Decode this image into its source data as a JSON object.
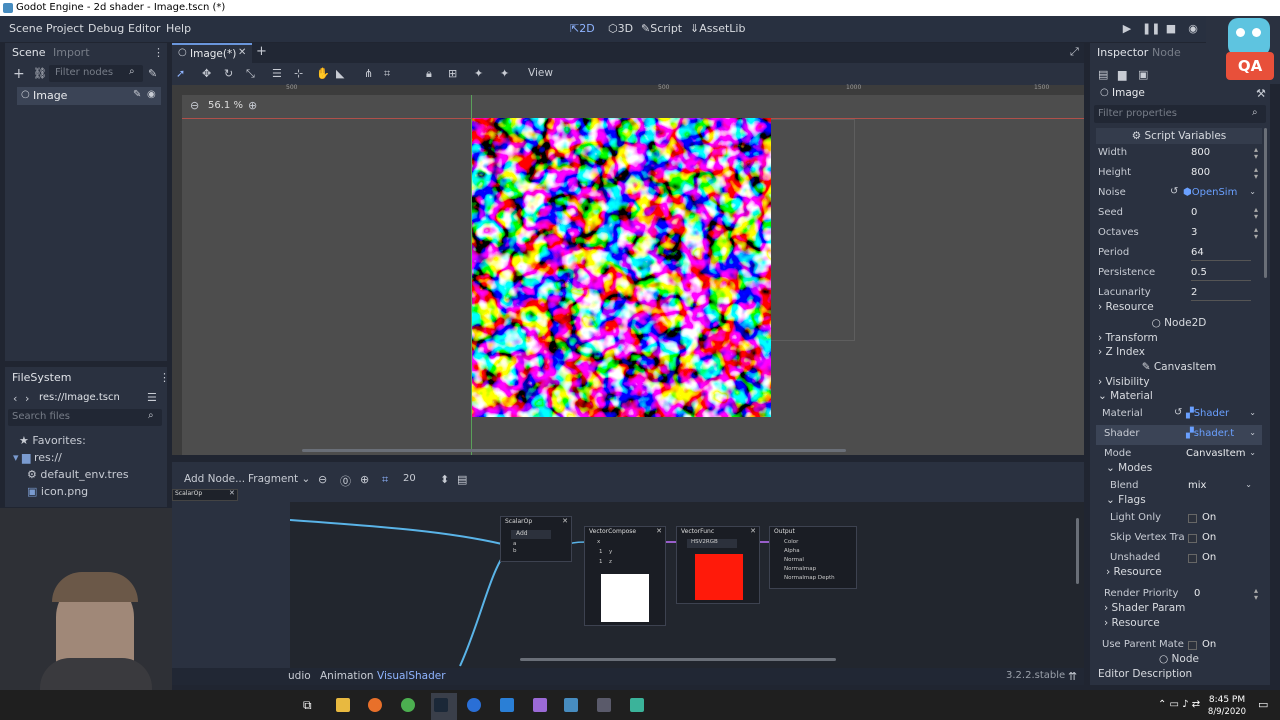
{
  "window": {
    "title": "Godot Engine - 2d shader - Image.tscn (*)"
  },
  "menu": [
    "Scene",
    "Project",
    "Debug",
    "Editor",
    "Help"
  ],
  "workspaces": [
    {
      "label": "2D",
      "icon": "2d-icon",
      "active": true
    },
    {
      "label": "3D",
      "icon": "3d-icon",
      "active": false
    },
    {
      "label": "Script",
      "icon": "script-icon",
      "active": false
    },
    {
      "label": "AssetLib",
      "icon": "assetlib-icon",
      "active": false
    }
  ],
  "scene_dock": {
    "tabs": [
      "Scene",
      "Import"
    ],
    "filter_placeholder": "Filter nodes",
    "tree": [
      {
        "label": "Image",
        "selected": true
      }
    ]
  },
  "filesystem_dock": {
    "title": "FileSystem",
    "path": "res://Image.tscn",
    "search_placeholder": "Search files",
    "items": [
      {
        "label": "Favorites:",
        "icon": "star-icon"
      },
      {
        "label": "res://",
        "icon": "folder-icon"
      },
      {
        "label": "default_env.tres",
        "icon": "resource-icon"
      },
      {
        "label": "icon.png",
        "icon": "image-icon"
      }
    ]
  },
  "editor_tabs": [
    {
      "label": "Image(*)",
      "closable": true
    }
  ],
  "viewport": {
    "zoom": "56.1 %",
    "view_menu": "View",
    "ruler_marks": [
      "500",
      "500",
      "1000",
      "1500"
    ],
    "colors": {
      "background": "#4d4d4d",
      "canvas": "#505050"
    }
  },
  "shader_editor": {
    "add_node": "Add Node...",
    "mode": "Fragment",
    "snap_value": "20",
    "mini_tab": "ScalarOp",
    "nodes": {
      "scalar_op": {
        "title": "ScalarOp",
        "op": "Add",
        "ports": [
          "a",
          "b"
        ]
      },
      "vector_compose": {
        "title": "VectorCompose",
        "ports": [
          "x",
          "y",
          "z"
        ],
        "values": [
          "1",
          "1"
        ]
      },
      "vector_func": {
        "title": "VectorFunc",
        "func": "HSV2RGB",
        "preview_color": "#ff1a0a"
      },
      "output": {
        "title": "Output",
        "ports": [
          "Color",
          "Alpha",
          "Normal",
          "Normalmap",
          "Normalmap Depth"
        ]
      }
    },
    "bottom_tabs": [
      "udio",
      "Animation",
      "VisualShader"
    ],
    "version": "3.2.2.stable"
  },
  "inspector": {
    "tabs": [
      "Inspector",
      "Node"
    ],
    "node_name": "Image",
    "filter_placeholder": "Filter properties",
    "script_variables": "Script Variables",
    "props": [
      {
        "label": "Width",
        "value": "800"
      },
      {
        "label": "Height",
        "value": "800"
      },
      {
        "label": "Noise",
        "value": "OpenSim"
      },
      {
        "label": "Seed",
        "value": "0"
      },
      {
        "label": "Octaves",
        "value": "3"
      },
      {
        "label": "Period",
        "value": "64"
      },
      {
        "label": "Persistence",
        "value": "0.5"
      },
      {
        "label": "Lacunarity",
        "value": "2"
      }
    ],
    "resource": "Resource",
    "node2d": "Node2D",
    "transform": "Transform",
    "zindex": "Z Index",
    "canvasitem": "CanvasItem",
    "visibility": "Visibility",
    "material_section": "Material",
    "material": {
      "label": "Material",
      "value": "Shader"
    },
    "shader": {
      "label": "Shader",
      "value": "shader.t"
    },
    "mode": {
      "label": "Mode",
      "value": "CanvasItem"
    },
    "modes": "Modes",
    "blend": {
      "label": "Blend",
      "value": "mix"
    },
    "flags": "Flags",
    "flag_items": [
      {
        "label": "Light Only",
        "value": "On"
      },
      {
        "label": "Skip Vertex Tra",
        "value": "On"
      },
      {
        "label": "Unshaded",
        "value": "On"
      }
    ],
    "resource2": "Resource",
    "render_priority": {
      "label": "Render Priority",
      "value": "0"
    },
    "shader_param": "Shader Param",
    "resource3": "Resource",
    "use_parent": {
      "label": "Use Parent Mate",
      "value": "On"
    },
    "node_section": "Node",
    "editor_description": "Editor Description"
  },
  "taskbar": {
    "time": "8:45 PM",
    "date": "8/9/2020"
  },
  "badge": {
    "text": "QA"
  }
}
